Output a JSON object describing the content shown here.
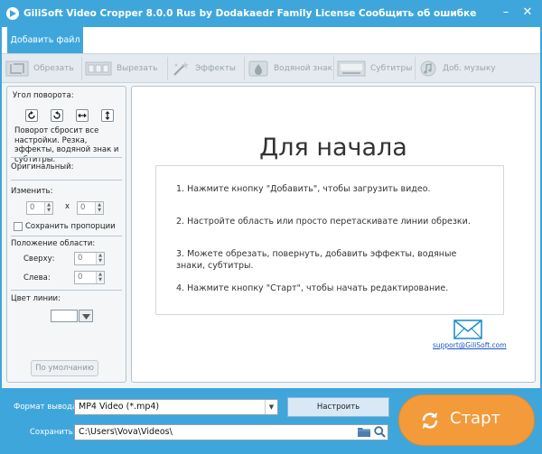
{
  "window": {
    "title": "GiliSoft Video Cropper 8.0.0 Rus by Dodakaedr Family License",
    "report_error": "Сообщить об ошибке",
    "minimize_glyph": "–",
    "close_glyph": "✕"
  },
  "add_file": {
    "label": "Добавить файл"
  },
  "toolbar": {
    "items": [
      {
        "label": "Обрезать",
        "icon": "crop-icon"
      },
      {
        "label": "Вырезать",
        "icon": "film-cut-icon"
      },
      {
        "label": "Эффекты",
        "icon": "effects-icon"
      },
      {
        "label": "Водяной знак",
        "icon": "watermark-icon"
      },
      {
        "label": "Субтитры",
        "icon": "subtitles-icon"
      },
      {
        "label": "Доб. музыку",
        "icon": "music-icon"
      }
    ]
  },
  "left_panel": {
    "rotation_label": "Угол поворота:",
    "rotation_buttons": [
      "rotate-clockwise-icon",
      "rotate-counterclockwise-icon",
      "flip-horizontal-icon",
      "flip-vertical-icon"
    ],
    "rotation_note": "Поворот сбросит все настройки. Резка, эффекты, водяной знак и субтитры.",
    "original_label": "Оригинальный:",
    "resize_label": "Изменить:",
    "width_value": "0",
    "height_value": "0",
    "x_sep": "x",
    "keep_ratio_label": "Сохранить пропорции",
    "keep_ratio_checked": false,
    "position_label": "Положение области:",
    "top_label": "Сверху:",
    "top_value": "0",
    "left_label": "Слева:",
    "left_value": "0",
    "line_color_label": "Цвет линии:",
    "line_color": "#ffffff",
    "default_button": "По умолчанию"
  },
  "preview": {
    "heading": "Для начала",
    "steps": [
      "1. Нажмите кнопку \"Добавить\", чтобы загрузить видео.",
      "2. Настройте область или просто перетаскивате линии обрезки.",
      "3. Можете обрезать, повернуть, добавить эффекты, водяные знаки, субтитры.",
      "4. Нажмите кнопку \"Старт\", чтобы начать редактирование."
    ],
    "support_email": "support@GiliSoft.com"
  },
  "bottom": {
    "format_label": "Формат вывода:",
    "format_value": "MP4 Video (*.mp4)",
    "settings_button": "Настроить",
    "save_label": "Сохранить:",
    "save_path": "C:\\Users\\Vova\\Videos\\",
    "start_button": "Старт"
  },
  "colors": {
    "accent": "#3fa6dc",
    "start": "#f39a3b",
    "link": "#1a56c2"
  }
}
